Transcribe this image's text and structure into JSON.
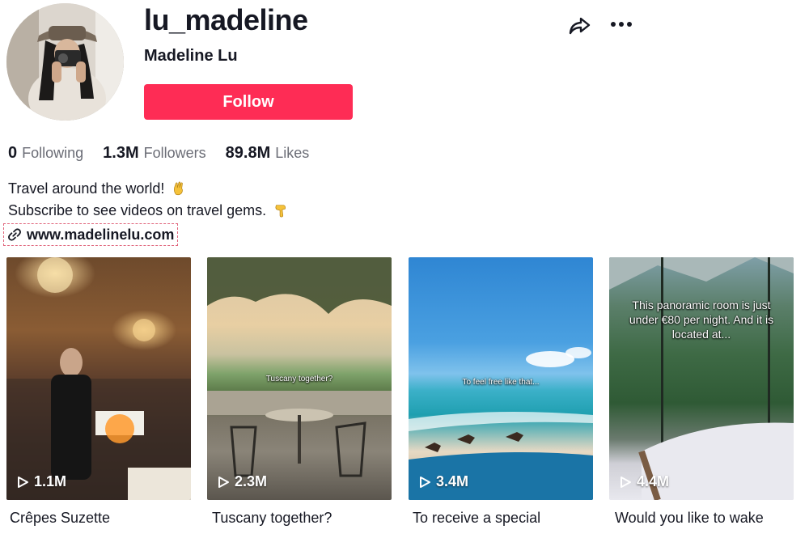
{
  "profile": {
    "username": "lu_madeline",
    "display_name": "Madeline Lu",
    "follow_label": "Follow"
  },
  "stats": [
    {
      "value": "0",
      "label": "Following"
    },
    {
      "value": "1.3M",
      "label": "Followers"
    },
    {
      "value": "89.8M",
      "label": "Likes"
    }
  ],
  "bio": {
    "line1": "Travel around the world!",
    "line1_icon": "ok-hand-emoji",
    "line2": "Subscribe to see videos on travel gems.",
    "line2_icon": "pointing-down-emoji"
  },
  "link": {
    "text": "www.madelinelu.com",
    "icon": "link-icon"
  },
  "icons": {
    "share": "share-icon",
    "more": "more-icon"
  },
  "colors": {
    "accent": "#fe2c55",
    "text": "#161823",
    "muted": "#6b6d76"
  },
  "videos": [
    {
      "views": "1.1M",
      "caption": "Crêpes Suzette",
      "overlay": ""
    },
    {
      "views": "2.3M",
      "caption": "Tuscany together?",
      "overlay": "Tuscany together?"
    },
    {
      "views": "3.4M",
      "caption": "To receive a special",
      "overlay": "To feel free like that..."
    },
    {
      "views": "4.4M",
      "caption": "Would you like to wake",
      "overlay": "This panoramic room is just under €80 per night. And it is located at..."
    }
  ]
}
